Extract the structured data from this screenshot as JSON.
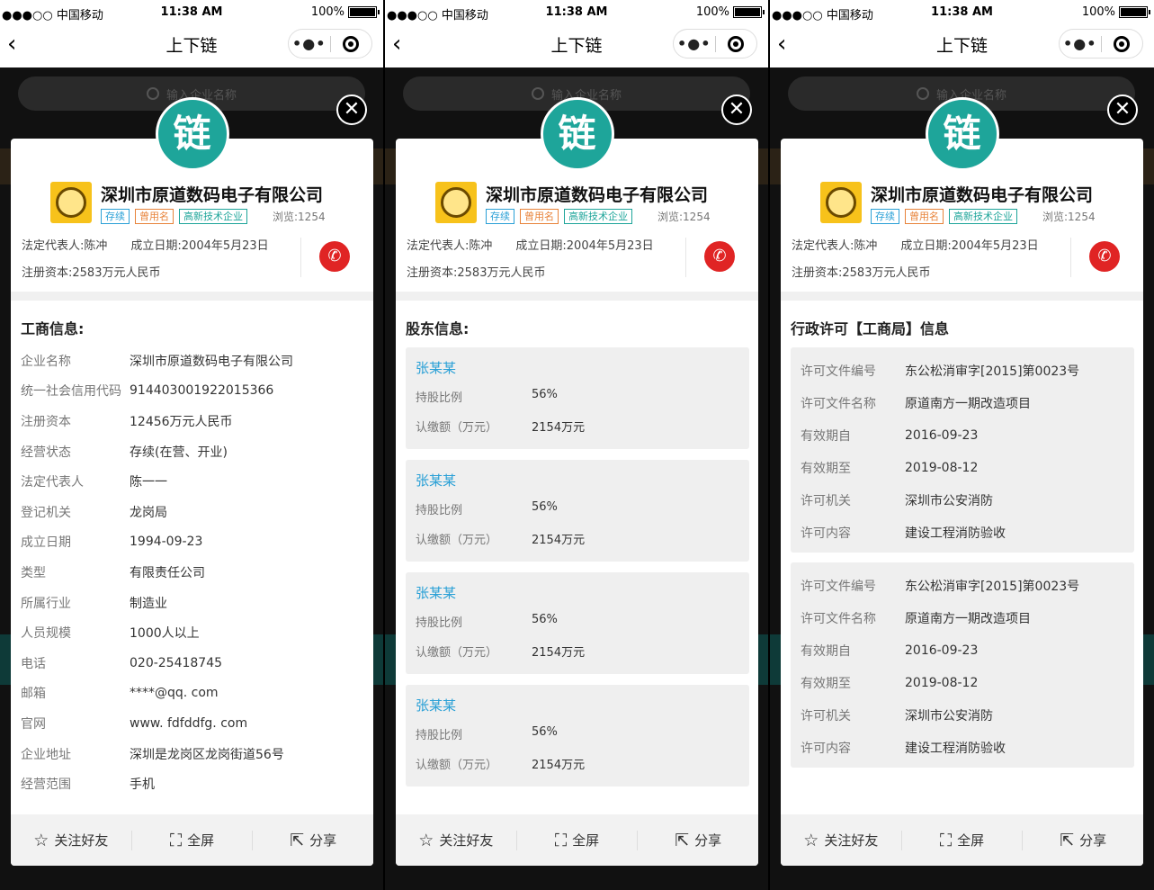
{
  "status": {
    "carrier": "●●●○○ 中国移动",
    "time": "11:38 AM",
    "battery": "100%"
  },
  "nav": {
    "back_icon": "‹",
    "title": "上下链",
    "more_icon": "•●•"
  },
  "backdrop": {
    "search_placeholder": "输入企业名称"
  },
  "modal": {
    "close_icon": "✕",
    "badge": "链"
  },
  "company": {
    "name": "深圳市原道数码电子有限公司",
    "tags": [
      "存续",
      "曾用名",
      "高新技术企业"
    ],
    "views": "浏览:1254",
    "legal_rep": "法定代表人:陈冲",
    "founded": "成立日期:2004年5月23日",
    "capital": "注册资本:2583万元人民币",
    "phone_icon": "✆"
  },
  "business": {
    "title": "工商信息:",
    "rows": [
      {
        "k": "企业名称",
        "v": "深圳市原道数码电子有限公司"
      },
      {
        "k": "统一社会信用代码",
        "v": "914403001922015366"
      },
      {
        "k": "注册资本",
        "v": "12456万元人民币"
      },
      {
        "k": "经营状态",
        "v": "存续(在营、开业)"
      },
      {
        "k": "法定代表人",
        "v": "陈一一"
      },
      {
        "k": "登记机关",
        "v": "龙岗局"
      },
      {
        "k": "成立日期",
        "v": "1994-09-23"
      },
      {
        "k": "类型",
        "v": "有限责任公司"
      },
      {
        "k": "所属行业",
        "v": "制造业"
      },
      {
        "k": "人员规模",
        "v": "1000人以上"
      },
      {
        "k": "电话",
        "v": "020-25418745"
      },
      {
        "k": "邮箱",
        "v": "****@qq. com"
      },
      {
        "k": "官网",
        "v": "www. fdfddfg. com"
      },
      {
        "k": "企业地址",
        "v": "深圳是龙岗区龙岗街道56号"
      },
      {
        "k": "经营范围",
        "v": "手机"
      }
    ]
  },
  "shareholders": {
    "title": "股东信息:",
    "items": [
      {
        "name": "张某某",
        "ratio_label": "持股比例",
        "ratio": "56%",
        "amount_label": "认缴额（万元）",
        "amount": "2154万元"
      },
      {
        "name": "张某某",
        "ratio_label": "持股比例",
        "ratio": "56%",
        "amount_label": "认缴额（万元）",
        "amount": "2154万元"
      },
      {
        "name": "张某某",
        "ratio_label": "持股比例",
        "ratio": "56%",
        "amount_label": "认缴额（万元）",
        "amount": "2154万元"
      },
      {
        "name": "张某某",
        "ratio_label": "持股比例",
        "ratio": "56%",
        "amount_label": "认缴额（万元）",
        "amount": "2154万元"
      }
    ]
  },
  "permits": {
    "title": "行政许可【工商局】信息",
    "items": [
      {
        "rows": [
          {
            "k": "许可文件编号",
            "v": "东公松消审字[2015]第0023号"
          },
          {
            "k": "许可文件名称",
            "v": "原道南方一期改造项目"
          },
          {
            "k": "有效期自",
            "v": "2016-09-23"
          },
          {
            "k": "有效期至",
            "v": "2019-08-12"
          },
          {
            "k": "许可机关",
            "v": "深圳市公安消防"
          },
          {
            "k": "许可内容",
            "v": "建设工程消防验收"
          }
        ]
      },
      {
        "rows": [
          {
            "k": "许可文件编号",
            "v": "东公松消审字[2015]第0023号"
          },
          {
            "k": "许可文件名称",
            "v": "原道南方一期改造项目"
          },
          {
            "k": "有效期自",
            "v": "2016-09-23"
          },
          {
            "k": "有效期至",
            "v": "2019-08-12"
          },
          {
            "k": "许可机关",
            "v": "深圳市公安消防"
          },
          {
            "k": "许可内容",
            "v": "建设工程消防验收"
          }
        ]
      }
    ]
  },
  "toolbar": {
    "follow_icon": "☆",
    "follow": "关注好友",
    "fullscreen_icon": "⛶",
    "fullscreen": "全屏",
    "share_icon": "⇱",
    "share": "分享"
  },
  "colors": {
    "brand_teal": "#1ea59a",
    "link_blue": "#2aa0d6",
    "call_red": "#e02424"
  }
}
